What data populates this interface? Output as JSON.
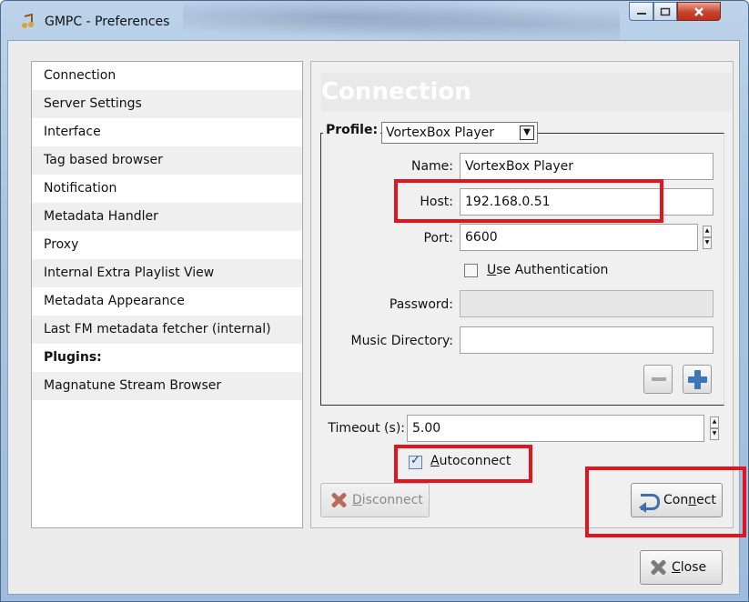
{
  "window": {
    "title": "GMPC - Preferences"
  },
  "sidebar": {
    "items": [
      {
        "label": "Connection",
        "bold": false
      },
      {
        "label": "Server Settings",
        "bold": false
      },
      {
        "label": "Interface",
        "bold": false
      },
      {
        "label": "Tag based browser",
        "bold": false
      },
      {
        "label": "Notification",
        "bold": false
      },
      {
        "label": "Metadata Handler",
        "bold": false
      },
      {
        "label": "Proxy",
        "bold": false
      },
      {
        "label": "Internal Extra Playlist View",
        "bold": false
      },
      {
        "label": "Metadata Appearance",
        "bold": false
      },
      {
        "label": "Last FM metadata fetcher (internal)",
        "bold": false
      },
      {
        "label": "Plugins:",
        "bold": true
      },
      {
        "label": "Magnatune Stream Browser",
        "bold": false
      }
    ]
  },
  "pane": {
    "heading": "Connection",
    "profile": {
      "label": "Profile:",
      "selected": "VortexBox Player"
    },
    "name": {
      "label": "Name:",
      "value": "VortexBox Player"
    },
    "host": {
      "label": "Host:",
      "value": "192.168.0.51"
    },
    "port": {
      "label": "Port:",
      "value": "6600"
    },
    "use_auth": {
      "label": "Use Authentication",
      "checked": false
    },
    "password": {
      "label": "Password:",
      "value": ""
    },
    "music_dir": {
      "label": "Music Directory:",
      "value": ""
    },
    "timeout": {
      "label": "Timeout (s):",
      "value": "5.00"
    },
    "autoconnect": {
      "label": "Autoconnect",
      "checked": true
    },
    "disconnect": {
      "label": "Disconnect"
    },
    "connect": {
      "label": "Connect"
    }
  },
  "footer": {
    "close": "Close"
  },
  "colors": {
    "highlight": "#e4141e",
    "heading_bg": "#e9e9e9"
  }
}
